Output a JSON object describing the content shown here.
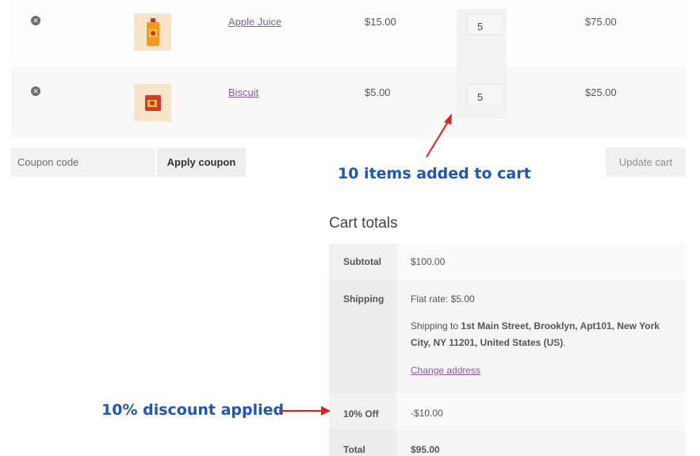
{
  "cart": {
    "items": [
      {
        "name": "Apple Juice",
        "price": "$15.00",
        "qty": "5",
        "subtotal": "$75.00",
        "image": "juice-bottle-icon"
      },
      {
        "name": "Biscuit",
        "price": "$5.00",
        "qty": "5",
        "subtotal": "$25.00",
        "image": "biscuit-pack-icon"
      }
    ],
    "remove_icon": "remove-icon",
    "coupon_placeholder": "Coupon code",
    "apply_coupon_label": "Apply coupon",
    "update_cart_label": "Update cart"
  },
  "annotations": {
    "items_added": "10 items added to cart",
    "discount_applied": "10% discount applied",
    "color": "#1e57b4",
    "arrow_color": "#e02020"
  },
  "totals": {
    "title": "Cart totals",
    "subtotal_label": "Subtotal",
    "subtotal_value": "$100.00",
    "shipping_label": "Shipping",
    "shipping_rate": "Flat rate: $5.00",
    "shipping_prefix": "Shipping to",
    "shipping_address": "1st Main Street, Brooklyn, Apt101, New York City, NY 11201, United States (US)",
    "shipping_suffix": ".",
    "change_address": "Change address",
    "discount_label": "10% Off",
    "discount_value": "-$10.00",
    "total_label": "Total",
    "total_value": "$95.00"
  }
}
